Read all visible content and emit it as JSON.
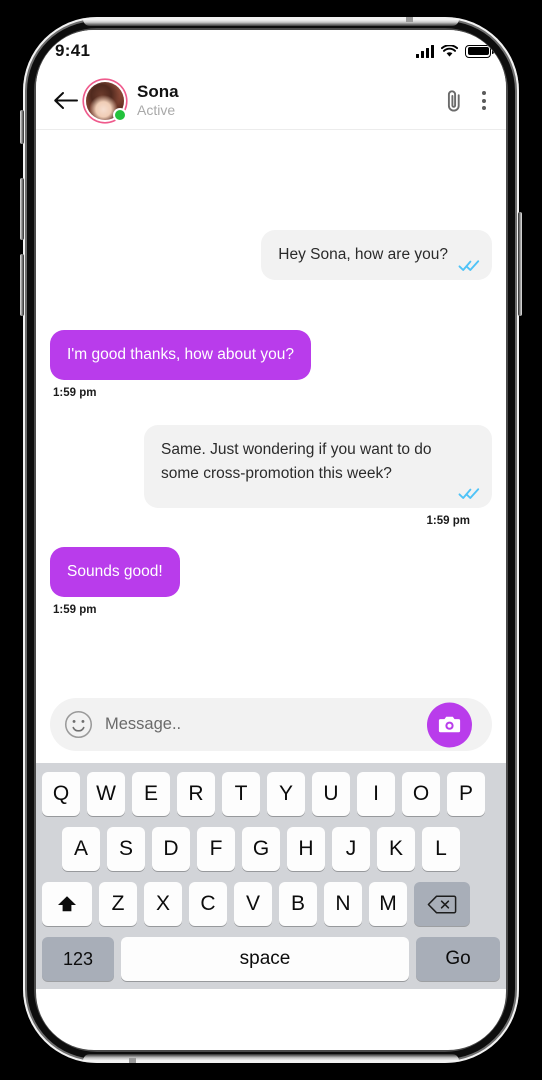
{
  "status_bar": {
    "time": "9:41",
    "signal_icon": "signal-bars-icon",
    "wifi_icon": "wifi-icon",
    "battery_icon": "battery-icon"
  },
  "header": {
    "back_icon": "back-arrow-icon",
    "avatar_alt": "avatar",
    "contact_name": "Sona",
    "contact_status": "Active",
    "attachment_icon": "paperclip-icon",
    "menu_icon": "more-vertical-icon",
    "online_indicator": "online-status-dot"
  },
  "messages": [
    {
      "id": "msg-1",
      "direction": "outgoing",
      "text": "Hey Sona, how are you?",
      "read_receipt": "double-check-icon",
      "timestamp": ""
    },
    {
      "id": "msg-2",
      "direction": "incoming",
      "text": "I'm good thanks, how about you?",
      "read_receipt": "",
      "timestamp": "1:59 pm"
    },
    {
      "id": "msg-3",
      "direction": "outgoing",
      "text": "Same.  Just wondering if you want to do some cross-promotion this week?",
      "read_receipt": "double-check-icon",
      "timestamp": "1:59 pm"
    },
    {
      "id": "msg-4",
      "direction": "incoming",
      "text": "Sounds good!",
      "read_receipt": "",
      "timestamp": "1:59 pm"
    }
  ],
  "input_bar": {
    "emoji_icon": "smiley-icon",
    "placeholder": "Message..",
    "value": "",
    "camera_icon": "camera-icon"
  },
  "keyboard": {
    "row1": [
      "Q",
      "W",
      "E",
      "R",
      "T",
      "Y",
      "U",
      "I",
      "O",
      "P"
    ],
    "row2": [
      "A",
      "S",
      "D",
      "F",
      "G",
      "H",
      "J",
      "K",
      "L"
    ],
    "row3": [
      "Z",
      "X",
      "C",
      "V",
      "B",
      "N",
      "M"
    ],
    "shift_icon": "shift-arrow-icon",
    "backspace_icon": "backspace-icon",
    "numeric_label": "123",
    "space_label": "space",
    "action_label": "Go"
  },
  "colors": {
    "accent_purple": "#b93ceb",
    "incoming_bubble": "#f2f2f2",
    "read_receipt_blue": "#4fc3f7",
    "online_green": "#22c23c",
    "avatar_ring": "#ef5a8c",
    "keyboard_bg": "#d2d4d8",
    "key_bg": "#fdfdfd",
    "key_dark_bg": "#a8aeb8"
  }
}
